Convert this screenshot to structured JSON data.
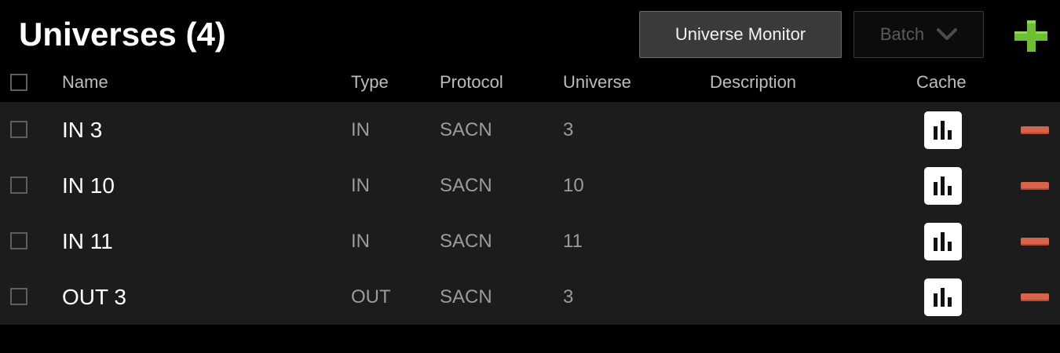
{
  "header": {
    "title": "Universes (4)",
    "monitor_label": "Universe Monitor",
    "batch_label": "Batch",
    "add_icon": "plus-icon"
  },
  "columns": {
    "name": "Name",
    "type": "Type",
    "protocol": "Protocol",
    "universe": "Universe",
    "description": "Description",
    "cache": "Cache"
  },
  "rows": [
    {
      "name": "IN 3",
      "type": "IN",
      "protocol": "SACN",
      "universe": "3",
      "description": ""
    },
    {
      "name": "IN 10",
      "type": "IN",
      "protocol": "SACN",
      "universe": "10",
      "description": ""
    },
    {
      "name": "IN 11",
      "type": "IN",
      "protocol": "SACN",
      "universe": "11",
      "description": ""
    },
    {
      "name": "OUT 3",
      "type": "OUT",
      "protocol": "SACN",
      "universe": "3",
      "description": ""
    }
  ],
  "icons": {
    "cache": "bar-chart-icon",
    "remove": "minus-icon",
    "batch_dropdown": "chevron-down-icon"
  },
  "colors": {
    "background": "#000000",
    "row_background": "#1c1c1c",
    "add_accent": "#66b32e",
    "remove_accent": "#d9624a"
  }
}
